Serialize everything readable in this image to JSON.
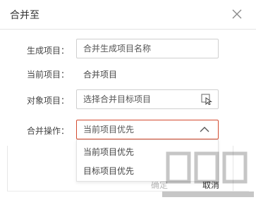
{
  "dialog": {
    "title": "合并至",
    "close_icon": "close-icon"
  },
  "form": {
    "generate": {
      "label": "生成项目：",
      "placeholder": "合并生成项目名称"
    },
    "current": {
      "label": "当前项目：",
      "value": "合并项目"
    },
    "target": {
      "label": "对象项目：",
      "placeholder": "选择合并目标项目",
      "icon": "cursor-pick-icon"
    },
    "operation": {
      "label": "合并操作：",
      "selected": "当前项目优先",
      "icon": "chevron-up-icon",
      "options": [
        "当前项目优先",
        "目标项目优先"
      ]
    }
  },
  "footer": {
    "ok_label": "确定",
    "cancel_label": "取消"
  },
  "colors": {
    "focus_border": "#d34a2f",
    "disabled_text": "#b8b8b8"
  }
}
